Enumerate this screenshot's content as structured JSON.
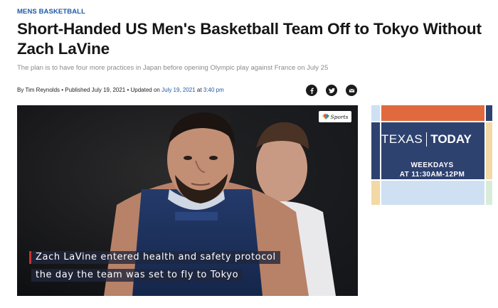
{
  "article": {
    "category": "MENS BASKETBALL",
    "headline": "Short-Handed US Men's Basketball Team Off to Tokyo Without Zach LaVine",
    "dek": "The plan is to have four more practices in Japan before opening Olympic play against France on July 25",
    "byline": {
      "author": "By Tim Reynolds",
      "published": "• Published July 19, 2021 • Updated on",
      "updated_date": "July 19, 2021",
      "at": "at",
      "updated_time": "3:40 pm"
    }
  },
  "share": {
    "icons": [
      "facebook-icon",
      "twitter-icon",
      "email-icon"
    ]
  },
  "video": {
    "logo_text": "Sports",
    "caption_line1": "Zach LaVine entered health and safety protocol",
    "caption_line2": "the day the team was set to fly to Tokyo"
  },
  "ad": {
    "brand_left": "TEXAS",
    "brand_right": "TODAY",
    "line1": "WEEKDAYS",
    "line2": "AT 11:30AM-12PM",
    "colors": {
      "navy": "#2e4270",
      "orange": "#e06a3e",
      "light_blue": "#cfe0f3",
      "sand": "#f2d9a5"
    }
  }
}
